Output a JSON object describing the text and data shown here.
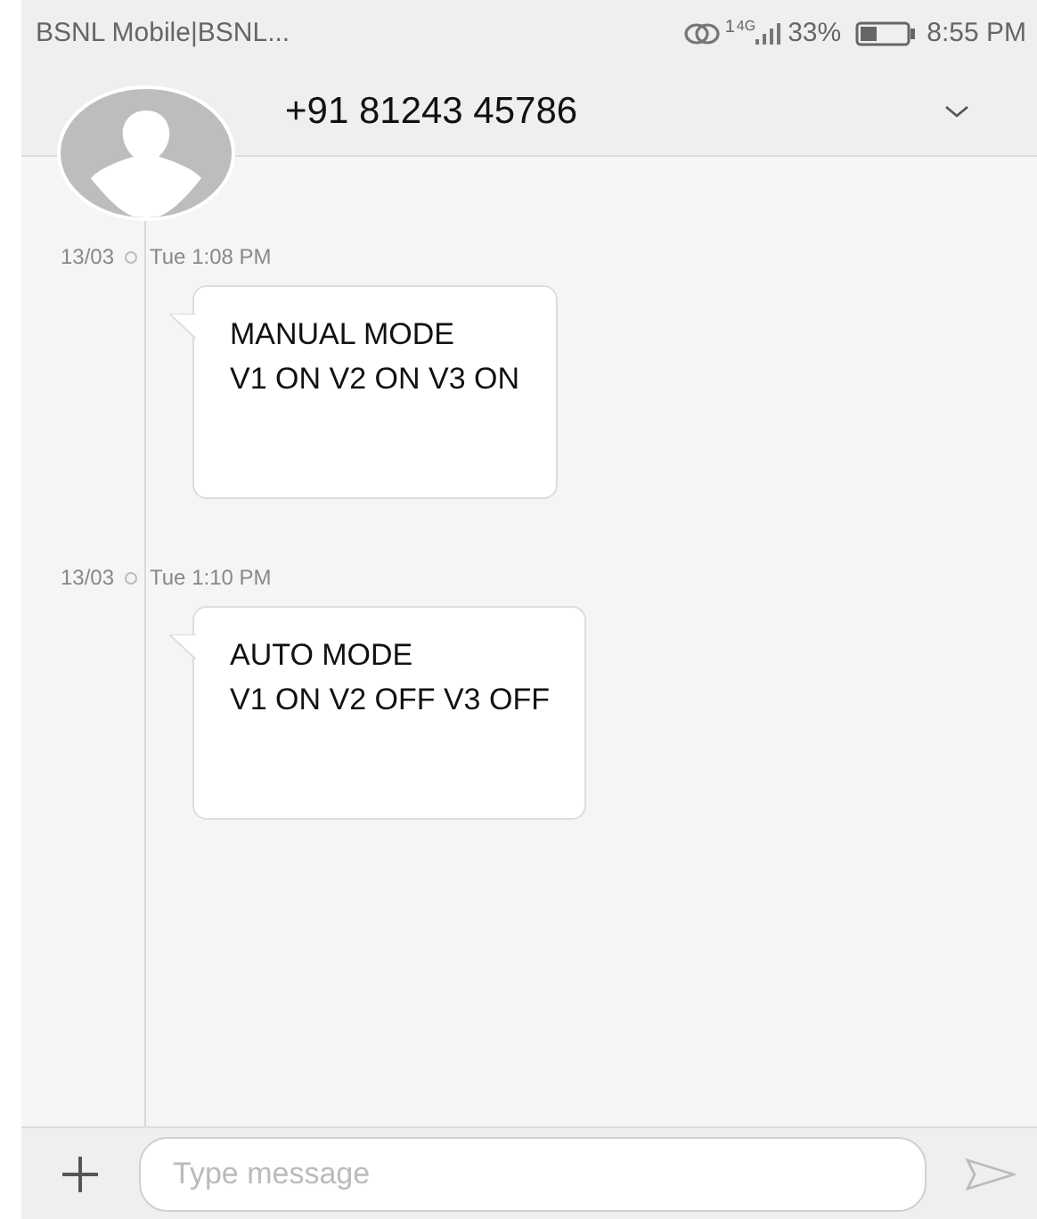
{
  "status_bar": {
    "carrier": "BSNL Mobile|BSNL...",
    "sim": "1",
    "network": "4G",
    "battery": "33%",
    "time": "8:55 PM"
  },
  "header": {
    "contact": "+91 81243 45786"
  },
  "messages": [
    {
      "date": "13/03",
      "time": "Tue 1:08 PM",
      "lines": [
        "MANUAL MODE",
        "V1 ON V2 ON V3 ON"
      ]
    },
    {
      "date": "13/03",
      "time": "Tue 1:10 PM",
      "lines": [
        "AUTO MODE",
        "V1 ON V2 OFF V3 OFF"
      ]
    }
  ],
  "composer": {
    "placeholder": "Type message"
  }
}
